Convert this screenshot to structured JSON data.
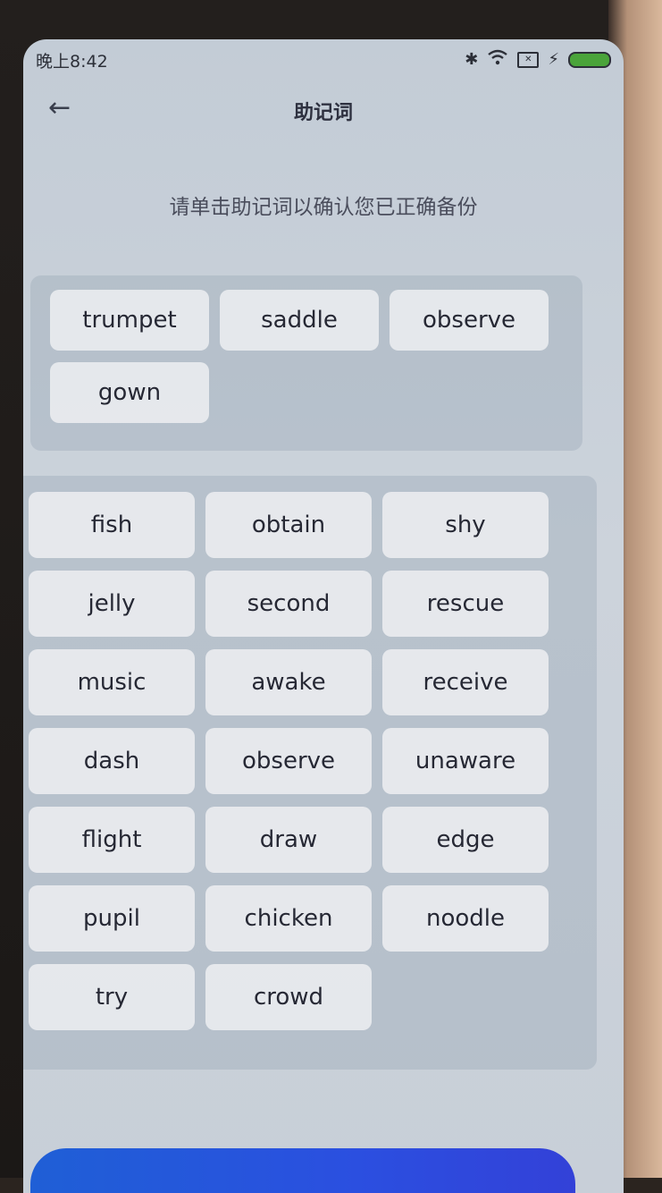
{
  "status_bar": {
    "time": "晚上8:42",
    "icons": [
      "bluetooth-icon",
      "wifi-icon",
      "sim-icon",
      "charging-icon",
      "battery-icon"
    ]
  },
  "header": {
    "title": "助记词",
    "back_icon": "arrow-left-icon"
  },
  "instruction": "请单击助记词以确认您已正确备份",
  "selected_words": [
    "trumpet",
    "saddle",
    "observe",
    "gown"
  ],
  "word_options": [
    "fish",
    "obtain",
    "shy",
    "jelly",
    "second",
    "rescue",
    "music",
    "awake",
    "receive",
    "dash",
    "observe",
    "unaware",
    "flight",
    "draw",
    "edge",
    "pupil",
    "chicken",
    "noodle",
    "try",
    "crowd"
  ],
  "colors": {
    "accent": "#2b4fe0",
    "chip_bg": "#e9ecef",
    "screen_bg": "#c8cfd8"
  }
}
